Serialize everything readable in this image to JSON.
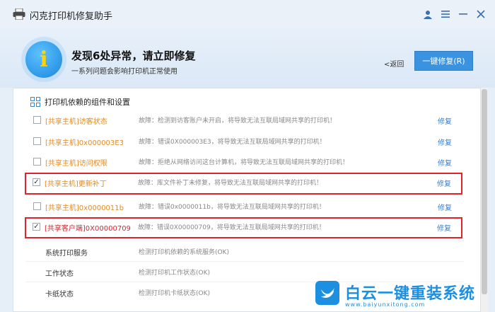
{
  "app": {
    "title": "闪克打印机修复助手"
  },
  "header": {
    "title": "发现6处异常，请立即修复",
    "subtitle": "一系列问题会影响打印机正常使用",
    "back_label": "<返回",
    "fix_all_label": "一键修复(R)",
    "info_glyph": "i"
  },
  "section": {
    "label": "打印机依赖的组件和设置"
  },
  "items": [
    {
      "name": "[共享主机]访客状态",
      "desc": "故障：检测到访客账户未开启，将导致无法互联局域网共享的打印机！",
      "fix": "修复",
      "checked": false,
      "highlighted": false
    },
    {
      "name": "[共享主机]0x000003E3",
      "desc": "故障：错误0X000003E3，将导致无法互联局域网共享的打印机！",
      "fix": "修复",
      "checked": false,
      "highlighted": false
    },
    {
      "name": "[共享主机]访问权限",
      "desc": "故障：拒绝从网络访问这台计算机，将导致无法互联局域网共享的打印机！",
      "fix": "修复",
      "checked": false,
      "highlighted": false
    },
    {
      "name": "[共享主机]更新补丁",
      "desc": "故障：库文件补丁未修复，将导致无法互联局域网共享的打印机！",
      "fix": "修复",
      "checked": true,
      "highlighted": true
    },
    {
      "name": "[共享主机]0x0000011b",
      "desc": "故障：错误0x0000011b，将导致无法互联局域网共享的打印机！",
      "fix": "修复",
      "checked": false,
      "highlighted": false
    },
    {
      "name": "[共享客户端]0X00000709",
      "desc": "故障：错误0X00000709，将导致无法互联局域网共享的打印机！",
      "fix": "修复",
      "checked": true,
      "highlighted": true
    }
  ],
  "status_items": [
    {
      "name": "系统打印服务",
      "desc": "检测打印机依赖的系统服务(OK)"
    },
    {
      "name": "工作状态",
      "desc": "检测打印机工作状态(OK)"
    },
    {
      "name": "卡纸状态",
      "desc": "检测打印机卡纸状态(OK)"
    }
  ],
  "watermark": {
    "text": "白云一键重装系统",
    "url": "www.baiyunxitong.com"
  },
  "colors": {
    "accent": "#3a93e0",
    "warning": "#e58a1f",
    "highlight": "#e0242b"
  }
}
